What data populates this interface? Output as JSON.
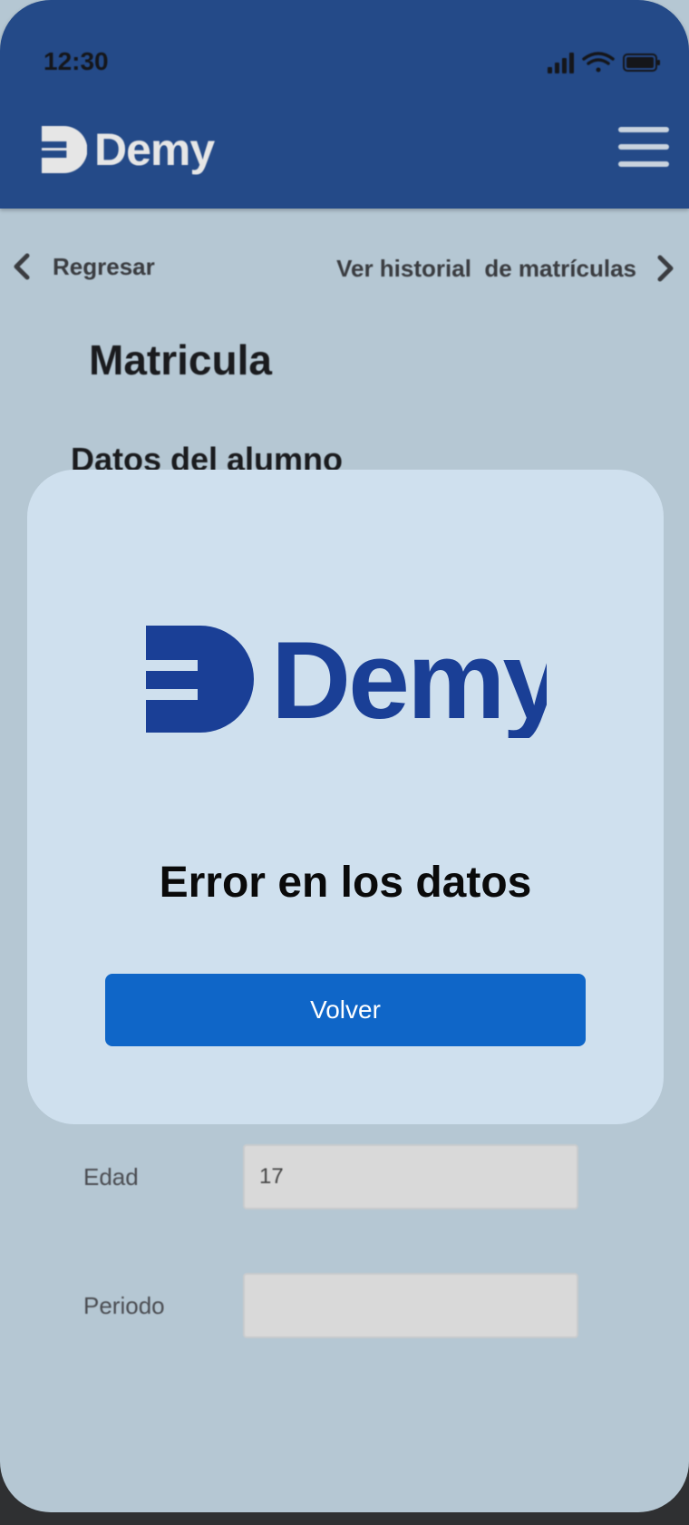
{
  "status_bar": {
    "time": "12:30"
  },
  "header": {
    "brand": "Demy",
    "menu_icon": "hamburger-menu-icon"
  },
  "nav": {
    "back_label": "Regresar",
    "history_label": "Ver historial  de matrículas"
  },
  "page": {
    "title": "Matricula",
    "section_title": "Datos del alumno"
  },
  "form": {
    "age": {
      "label": "Edad",
      "value": "17"
    },
    "period": {
      "label": "Periodo",
      "value": ""
    }
  },
  "modal": {
    "brand": "Demy",
    "message": "Error en los datos",
    "button_label": "Volver"
  },
  "colors": {
    "header_bg": "#244a88",
    "page_bg": "#b5c7d3",
    "modal_bg": "#cfe0ee",
    "brand_blue": "#1a3f96",
    "button_bg": "#0f66c8"
  }
}
